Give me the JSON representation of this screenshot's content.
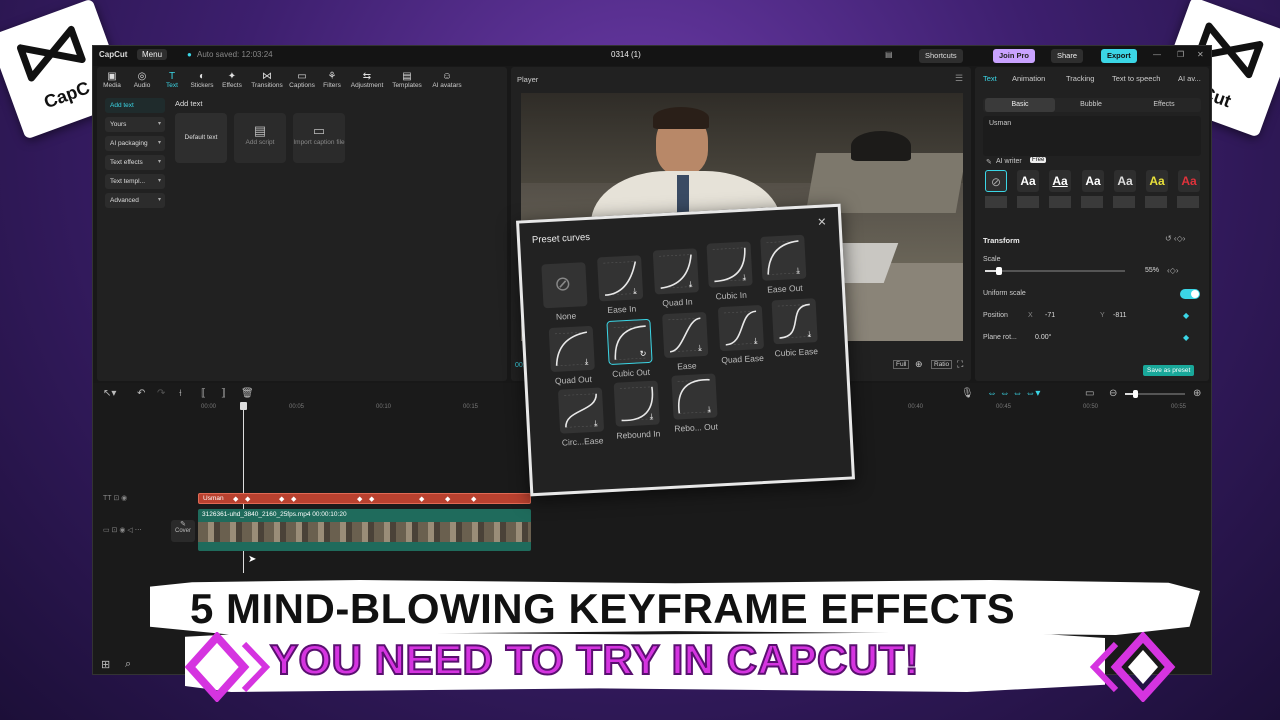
{
  "window": {
    "app_name": "CapCut",
    "menu": "Menu",
    "autosave": "Auto saved: 12:03:24",
    "project_title": "0314 (1)",
    "shortcuts": "Shortcuts",
    "join_pro": "Join Pro",
    "share": "Share",
    "export": "Export"
  },
  "toolbar": {
    "items": [
      "Media",
      "Audio",
      "Text",
      "Stickers",
      "Effects",
      "Transitions",
      "Captions",
      "Filters",
      "Adjustment",
      "Templates",
      "AI avatars"
    ],
    "active": "Text"
  },
  "left_panel": {
    "sidebar": [
      "Add text",
      "Yours",
      "AI packaging",
      "Text effects",
      "Text templ...",
      "Advanced"
    ],
    "section_title": "Add text",
    "cards": [
      "Default text",
      "Add script",
      "Import caption file"
    ]
  },
  "player": {
    "title": "Player",
    "timecode": "00:00",
    "controls": [
      "Full",
      "Ratio"
    ]
  },
  "right_panel": {
    "tabs": [
      "Text",
      "Animation",
      "Tracking",
      "Text to speech",
      "AI av..."
    ],
    "subtabs": [
      "Basic",
      "Bubble",
      "Effects"
    ],
    "text_value": "Usman",
    "ai_writer": "AI writer",
    "ai_writer_badge": "Free",
    "font_samples": [
      "Aa",
      "Aa",
      "Aa",
      "Aa",
      "Aa",
      "Aa"
    ],
    "transform": "Transform",
    "scale_label": "Scale",
    "scale_value": "55%",
    "scale_fraction": 0.1,
    "uniform_scale": "Uniform scale",
    "position_label": "Position",
    "pos_x_label": "X",
    "pos_x": "-71",
    "pos_y_label": "Y",
    "pos_y": "-811",
    "plane_rot_label": "Plane rot...",
    "plane_rot_value": "0.00°",
    "save_preset": "Save as preset"
  },
  "timeline": {
    "ruler": [
      "00:00",
      "00:05",
      "00:10",
      "00:15",
      "00:40",
      "00:45",
      "00:50",
      "00:55"
    ],
    "text_clip": "Usman",
    "video_clip": "3126361-uhd_3840_2160_25fps.mp4  00:00:10:20",
    "cover_label": "Cover"
  },
  "dialog": {
    "title": "Preset curves",
    "curves": [
      "None",
      "Ease In",
      "Quad In",
      "Cubic In",
      "Ease Out",
      "Quad Out",
      "Cubic Out",
      "Ease",
      "Quad Ease",
      "Cubic Ease",
      "Circ...Ease",
      "Rebound In",
      "Rebo... Out"
    ],
    "selected": "Cubic Out"
  },
  "banner": {
    "line1": "5 MIND-BLOWING KEYFRAME EFFECTS",
    "line2": "YOU NEED TO TRY IN CAPCUT!"
  },
  "logos": {
    "left_text": "CapC",
    "right_text": "Cut"
  },
  "colors": {
    "accent": "#3bd6e6",
    "text_clip": "#b9412f",
    "video_clip": "#1f6b5c",
    "headline_line1": "#111111",
    "headline_line2": "#d534e0",
    "join_pro": "#c9a2ff"
  }
}
